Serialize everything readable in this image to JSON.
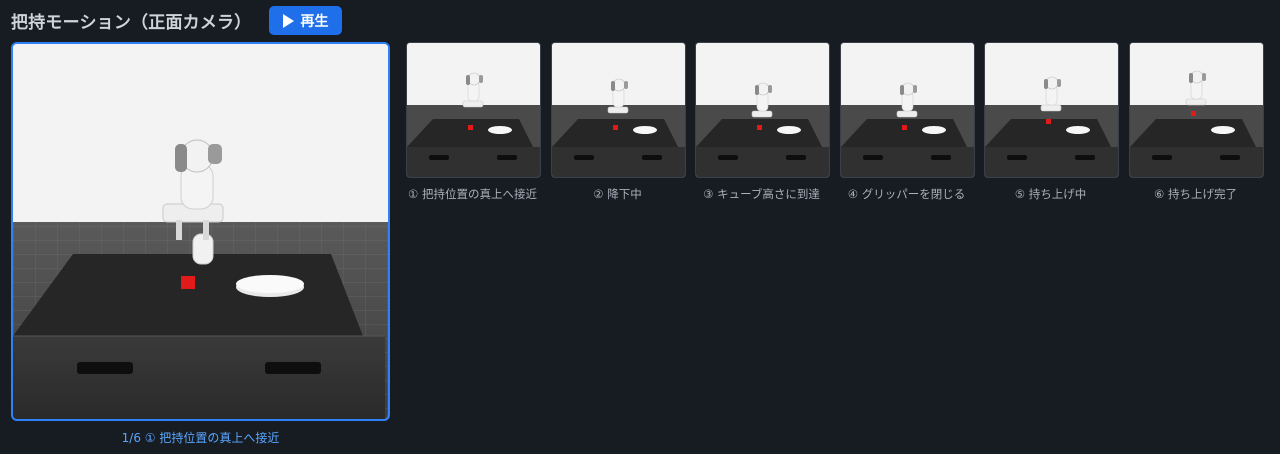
{
  "header": {
    "title": "把持モーション（正面カメラ）",
    "play_label": "再生"
  },
  "viewer": {
    "counter": "1/6",
    "caption": "① 把持位置の真上へ接近"
  },
  "frames": [
    {
      "label": "① 把持位置の真上へ接近"
    },
    {
      "label": "② 降下中"
    },
    {
      "label": "③ キューブ高さに到達"
    },
    {
      "label": "④ グリッパーを閉じる"
    },
    {
      "label": "⑤ 持ち上げ中"
    },
    {
      "label": "⑥ 持ち上げ完了"
    }
  ],
  "colors": {
    "accent": "#1f6feb",
    "active_border": "#2f81f7",
    "caption_active": "#58a6ff",
    "cube": "#e31a1a"
  }
}
